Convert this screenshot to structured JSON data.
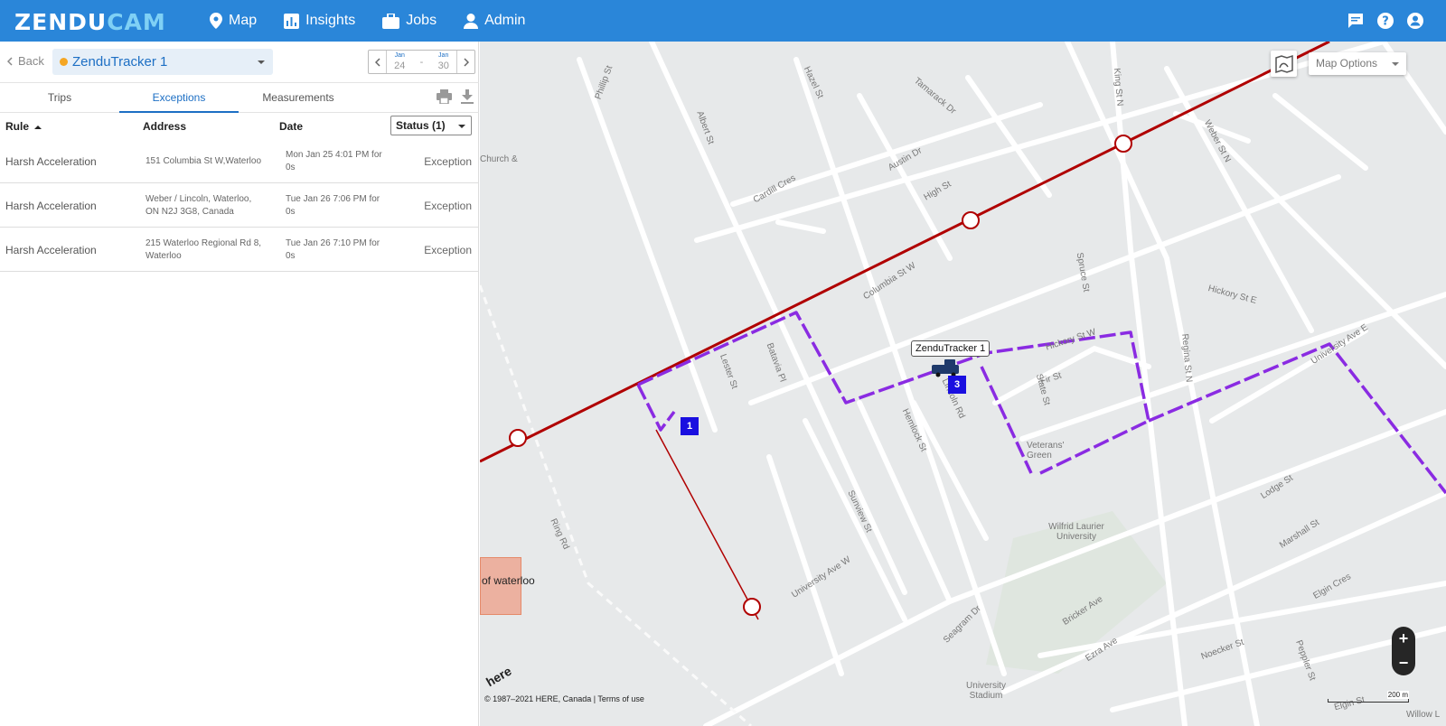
{
  "app": {
    "logo_a": "ZENDU",
    "logo_b": "CAM"
  },
  "nav": [
    {
      "label": "Map",
      "icon": "map-pin-icon"
    },
    {
      "label": "Insights",
      "icon": "bar-chart-icon"
    },
    {
      "label": "Jobs",
      "icon": "briefcase-icon"
    },
    {
      "label": "Admin",
      "icon": "user-icon"
    }
  ],
  "top_icons": [
    "chat-icon",
    "help-icon",
    "account-icon"
  ],
  "panel": {
    "back_label": "Back",
    "vehicle_name": "ZenduTracker 1",
    "vehicle_status_color": "#f5a623",
    "date_range": {
      "start_month": "Jan",
      "start_day": "24",
      "separator": "-",
      "end_month": "Jan",
      "end_day": "30"
    },
    "tabs": [
      "Trips",
      "Exceptions",
      "Measurements"
    ],
    "active_tab": "Exceptions",
    "table": {
      "headers": {
        "rule": "Rule",
        "address": "Address",
        "date": "Date"
      },
      "status_filter": "Status (1)",
      "rows": [
        {
          "rule": "Harsh Acceleration",
          "address": "151 Columbia St W,Waterloo",
          "date": "Mon Jan 25 4:01 PM for 0s",
          "status": "Exception"
        },
        {
          "rule": "Harsh Acceleration",
          "address": "Weber / Lincoln, Waterloo, ON N2J 3G8, Canada",
          "date": "Tue Jan 26 7:06 PM for 0s",
          "status": "Exception"
        },
        {
          "rule": "Harsh Acceleration",
          "address": "215 Waterloo Regional Rd 8, Waterloo",
          "date": "Tue Jan 26 7:10 PM for 0s",
          "status": "Exception"
        }
      ]
    }
  },
  "map": {
    "options_label": "Map Options",
    "vehicle_label": "ZenduTracker 1",
    "markers": [
      "1",
      "3"
    ],
    "zoom_in": "+",
    "zoom_out": "−",
    "attribution": "© 1987–2021 HERE, Canada | Terms of use",
    "scale": "200 m",
    "here_logo": "here",
    "geofence_label": "of waterloo",
    "route_color": "#8a2be2",
    "road_highlight_color": "#b00000",
    "street_labels": [
      "Phillip St",
      "Albert St",
      "Hazel St",
      "Columbia St W",
      "King St N",
      "Weber St N",
      "University Ave W",
      "University Ave E",
      "Lester St",
      "Hickory St W",
      "Fir St",
      "Lodge St",
      "Marshall St",
      "Seagram Dr",
      "Wilfrid Laurier University",
      "University Stadium",
      "Ring Rd",
      "Regina St N",
      "Spruce St",
      "Sunview St",
      "Hemlock St",
      "Lincoln Rd",
      "Batavia Pl",
      "Cardill Cres",
      "High St",
      "Austin Dr",
      "Tamarack Dr",
      "Bricker Ave",
      "Ezra Ave",
      "Noecker St",
      "Elgin Cres",
      "State St",
      "Veterans' Green",
      "Church &",
      "Peppler St",
      "Hickory St E",
      "Elgin St",
      "Willow L"
    ]
  }
}
